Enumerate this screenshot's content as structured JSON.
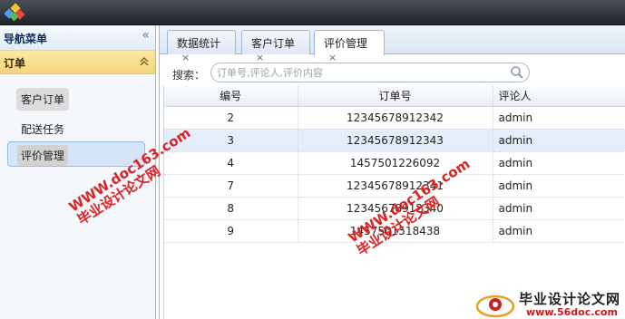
{
  "sidebar": {
    "title": "导航菜单",
    "collapse_icon": "double-chevron-left-icon",
    "group": {
      "title": "订单",
      "toggle_icon": "double-chevron-up-icon"
    },
    "items": [
      {
        "label": "客户订单"
      },
      {
        "label": "配送任务"
      },
      {
        "label": "评价管理"
      }
    ]
  },
  "tabs": [
    {
      "label": "数据统计",
      "close": "×"
    },
    {
      "label": "客户订单",
      "close": "×"
    },
    {
      "label": "评价管理",
      "close": "×"
    }
  ],
  "search": {
    "label": "搜索：",
    "placeholder": "订单号,评论人,评价内容"
  },
  "table": {
    "columns": [
      "编号",
      "订单号",
      "评论人"
    ],
    "rows": [
      {
        "id": "2",
        "order": "12345678912342",
        "user": "admin"
      },
      {
        "id": "3",
        "order": "12345678912343",
        "user": "admin"
      },
      {
        "id": "4",
        "order": "1457501226092",
        "user": "admin"
      },
      {
        "id": "7",
        "order": "12345678912341",
        "user": "admin"
      },
      {
        "id": "8",
        "order": "12345678912340",
        "user": "admin"
      },
      {
        "id": "9",
        "order": "1457501518438",
        "user": "admin"
      }
    ]
  },
  "watermarks": {
    "line1_cn": "毕业设计论文网",
    "line1_url": "WWW.doc163.com",
    "line2_cn": "毕业设计论文网",
    "line2_url": "WWW.doc163.com",
    "brand_cn": "毕业设计论文网",
    "brand_url": "www.56doc.com"
  },
  "colors": {
    "accent": "#95b8e7",
    "group_header": "#f5d47a",
    "selected_row": "#e4eefa",
    "watermark": "#dd2222"
  }
}
